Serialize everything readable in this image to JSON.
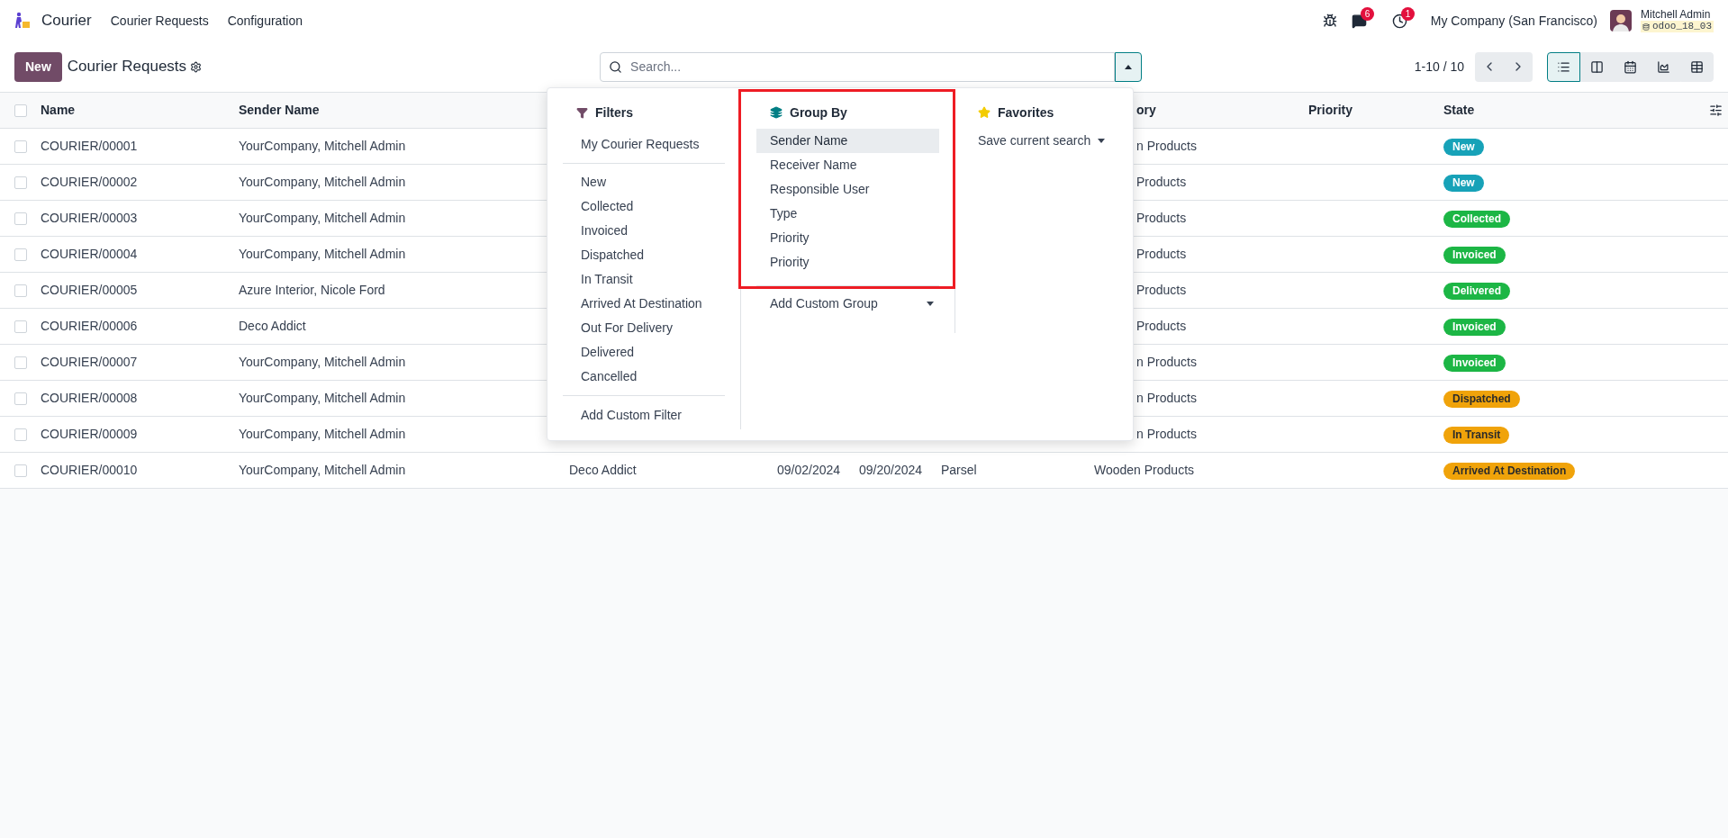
{
  "navbar": {
    "app_name": "Courier",
    "menus": [
      "Courier Requests",
      "Configuration"
    ],
    "chat_count": "6",
    "activity_count": "1",
    "company": "My Company (San Francisco)",
    "user_name": "Mitchell Admin",
    "database": "odoo_18_03"
  },
  "control_panel": {
    "new_button": "New",
    "title": "Courier Requests",
    "search": {
      "placeholder": "Search..."
    },
    "search_panel_open": true,
    "pager": "1-10 / 10",
    "views": [
      {
        "kind": "list",
        "selected": true
      },
      {
        "kind": "kanban",
        "selected": false
      },
      {
        "kind": "calendar",
        "selected": false
      },
      {
        "kind": "graph",
        "selected": false
      },
      {
        "kind": "pivot",
        "selected": false
      }
    ]
  },
  "search_panel": {
    "filters": {
      "title": "Filters",
      "groups": [
        [
          "My Courier Requests"
        ],
        [
          "New",
          "Collected",
          "Invoiced",
          "Dispatched",
          "In Transit",
          "Arrived At Destination",
          "Out For Delivery",
          "Delivered",
          "Cancelled"
        ]
      ],
      "custom": "Add Custom Filter"
    },
    "group_by": {
      "title": "Group By",
      "highlighted": true,
      "options": [
        {
          "label": "Sender Name",
          "selected": true
        },
        {
          "label": "Receiver Name",
          "selected": false
        },
        {
          "label": "Responsible User",
          "selected": false
        },
        {
          "label": "Type",
          "selected": false
        },
        {
          "label": "Priority",
          "selected": false
        },
        {
          "label": "Priority",
          "selected": false
        }
      ],
      "custom": "Add Custom Group"
    },
    "favorites": {
      "title": "Favorites",
      "save": "Save current search"
    }
  },
  "table": {
    "select_all_checked": false,
    "columns": [
      {
        "label": "Name"
      },
      {
        "label": "Sender Name"
      },
      {
        "label": "ory"
      },
      {
        "label": "Priority"
      },
      {
        "label": "State"
      }
    ],
    "rows": [
      {
        "name": "COURIER/00001",
        "checked": false,
        "sender": "YourCompany, Mitchell Admin",
        "category": "n Products",
        "state": {
          "label": "New",
          "color": "#17a2b8"
        }
      },
      {
        "name": "COURIER/00002",
        "checked": false,
        "sender": "YourCompany, Mitchell Admin",
        "category": "Products",
        "state": {
          "label": "New",
          "color": "#17a2b8"
        }
      },
      {
        "name": "COURIER/00003",
        "checked": false,
        "sender": "YourCompany, Mitchell Admin",
        "category": "Products",
        "state": {
          "label": "Collected",
          "color": "#1cb645"
        }
      },
      {
        "name": "COURIER/00004",
        "checked": false,
        "sender": "YourCompany, Mitchell Admin",
        "category": "Products",
        "state": {
          "label": "Invoiced",
          "color": "#1cb645"
        }
      },
      {
        "name": "COURIER/00005",
        "checked": false,
        "sender": "Azure Interior, Nicole Ford",
        "category": "Products",
        "state": {
          "label": "Delivered",
          "color": "#1cb645"
        }
      },
      {
        "name": "COURIER/00006",
        "checked": false,
        "sender": "Deco Addict",
        "category": "Products",
        "state": {
          "label": "Invoiced",
          "color": "#1cb645"
        }
      },
      {
        "name": "COURIER/00007",
        "checked": false,
        "sender": "YourCompany, Mitchell Admin",
        "category": "n Products",
        "state": {
          "label": "Invoiced",
          "color": "#1cb645"
        }
      },
      {
        "name": "COURIER/00008",
        "checked": false,
        "sender": "YourCompany, Mitchell Admin",
        "category": "n Products",
        "state": {
          "label": "Dispatched",
          "color": "#f0a30a"
        }
      },
      {
        "name": "COURIER/00009",
        "checked": false,
        "sender": "YourCompany, Mitchell Admin",
        "category": "n Products",
        "state": {
          "label": "In Transit",
          "color": "#f0a30a"
        }
      },
      {
        "name": "COURIER/00010",
        "checked": false,
        "sender": "YourCompany, Mitchell Admin",
        "receiver": "Deco Addict",
        "date_1": "09/02/2024",
        "date_2": "09/20/2024",
        "type": "Parsel",
        "category": "Wooden Products",
        "state": {
          "label": "Arrived At Destination",
          "color": "#f0a30a"
        }
      }
    ]
  }
}
